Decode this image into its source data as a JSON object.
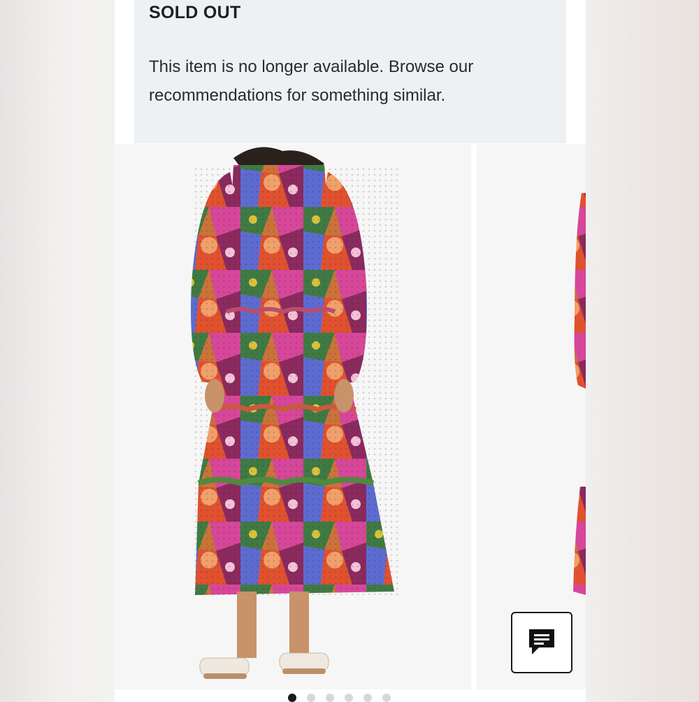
{
  "banner": {
    "title": "SOLD OUT",
    "message": "This item is no longer available. Browse our recommendations for something similar."
  },
  "gallery": {
    "current_index": 0,
    "slide_count": 6,
    "slides": [
      {
        "alt": "colorful patchwork print maxi dress front view"
      },
      {
        "alt": "colorful patchwork print maxi dress side view"
      }
    ]
  },
  "chat": {
    "icon": "chat-bubble-icon"
  },
  "colors": {
    "banner_bg": "#eef1f4",
    "active_dot": "#1a1a1a",
    "inactive_dot": "#d8d8d8"
  }
}
